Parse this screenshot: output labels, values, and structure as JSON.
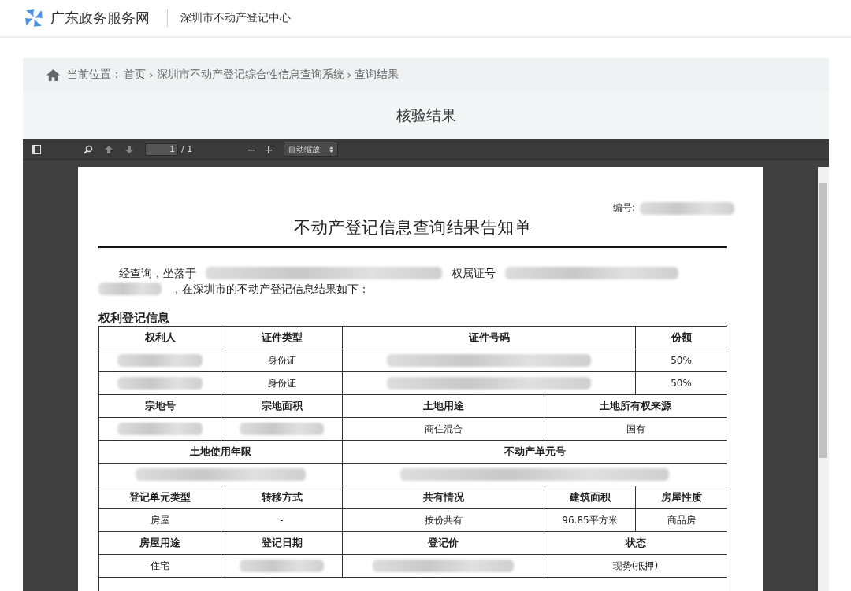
{
  "header": {
    "site_name": "广东政务服务网",
    "department": "深圳市不动产登记中心"
  },
  "breadcrumb": {
    "label": "当前位置：",
    "items": [
      "首页",
      "深圳市不动产登记综合性信息查询系统",
      "查询结果"
    ],
    "separator": "›"
  },
  "panel_title": "核验结果",
  "viewer": {
    "page_input": "1",
    "page_total": "/ 1",
    "zoom_select": "自动缩放",
    "minus": "−",
    "plus": "+"
  },
  "document": {
    "number_label": "编号:",
    "title": "不动产登记信息查询结果告知单",
    "intro": [
      {
        "kind": "text",
        "text": "经查询，坐落于"
      },
      {
        "kind": "redacted"
      },
      {
        "kind": "text",
        "text": "权属证号"
      },
      {
        "kind": "redacted"
      },
      {
        "kind": "redacted"
      },
      {
        "kind": "text",
        "text": "，在深圳市的不动产登记信息结果如下："
      }
    ],
    "section_title": "权利登记信息",
    "rows": [
      [
        {
          "kind": "header",
          "text": "权利人"
        },
        {
          "kind": "header",
          "text": "证件类型"
        },
        {
          "kind": "header",
          "text": "证件号码"
        },
        {
          "kind": "header",
          "text": "份额"
        }
      ],
      [
        {
          "kind": "redacted"
        },
        {
          "kind": "value",
          "text": "身份证"
        },
        {
          "kind": "redacted"
        },
        {
          "kind": "value",
          "text": "50%"
        }
      ],
      [
        {
          "kind": "redacted"
        },
        {
          "kind": "value",
          "text": "身份证"
        },
        {
          "kind": "redacted"
        },
        {
          "kind": "value",
          "text": "50%"
        }
      ],
      [
        {
          "kind": "header",
          "text": "宗地号"
        },
        {
          "kind": "header",
          "text": "宗地面积"
        },
        {
          "kind": "header",
          "text": "土地用途"
        },
        {
          "kind": "header",
          "text": "土地所有权来源"
        }
      ],
      [
        {
          "kind": "redacted"
        },
        {
          "kind": "redacted"
        },
        {
          "kind": "value",
          "text": "商住混合"
        },
        {
          "kind": "value",
          "text": "国有"
        }
      ],
      [
        {
          "kind": "header",
          "text": "土地使用年限"
        },
        {
          "kind": "header",
          "text": "不动产单元号"
        }
      ],
      [
        {
          "kind": "redacted"
        },
        {
          "kind": "redacted"
        }
      ],
      [
        {
          "kind": "header",
          "text": "登记单元类型"
        },
        {
          "kind": "header",
          "text": "转移方式"
        },
        {
          "kind": "header",
          "text": "共有情况"
        },
        {
          "kind": "header",
          "text": "建筑面积"
        },
        {
          "kind": "header",
          "text": "房屋性质"
        }
      ],
      [
        {
          "kind": "value",
          "text": "房屋"
        },
        {
          "kind": "value",
          "text": "-"
        },
        {
          "kind": "value",
          "text": "按份共有"
        },
        {
          "kind": "value",
          "text": "96.85平方米"
        },
        {
          "kind": "value",
          "text": "商品房"
        }
      ],
      [
        {
          "kind": "header",
          "text": "房屋用途"
        },
        {
          "kind": "header",
          "text": "登记日期"
        },
        {
          "kind": "header",
          "text": "登记价"
        },
        {
          "kind": "header",
          "text": "状态"
        }
      ],
      [
        {
          "kind": "value",
          "text": "住宅"
        },
        {
          "kind": "redacted"
        },
        {
          "kind": "redacted"
        },
        {
          "kind": "value",
          "text": "现势(抵押)"
        }
      ]
    ]
  }
}
